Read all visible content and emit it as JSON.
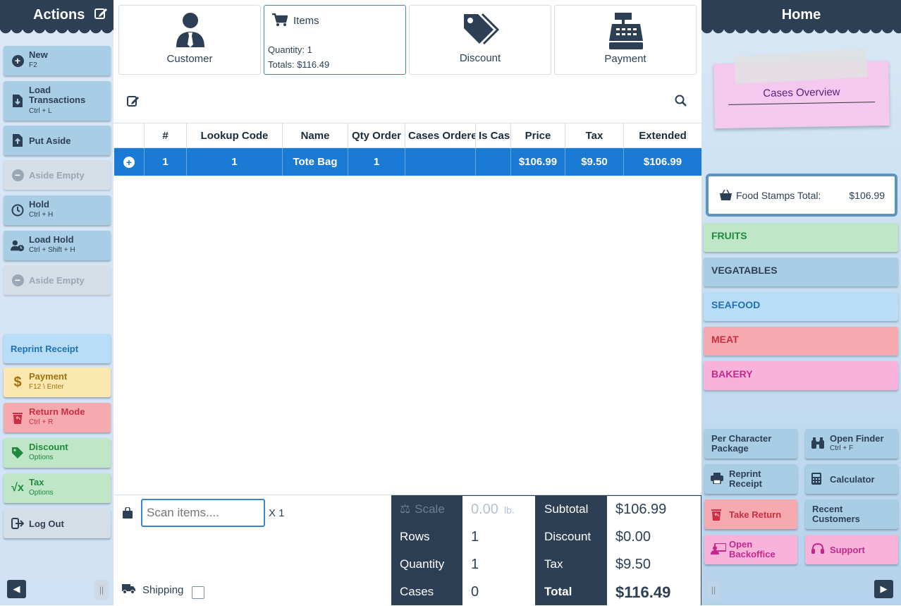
{
  "left_panel": {
    "title": "Actions",
    "buttons": [
      {
        "label": "New",
        "shortcut": "F2"
      },
      {
        "label": "Load",
        "label2": "Transactions",
        "shortcut": "Ctrl + L"
      },
      {
        "label": "Put Aside"
      },
      {
        "label": "Aside Empty"
      },
      {
        "label": "Hold",
        "shortcut": "Ctrl + H"
      },
      {
        "label": "Load Hold",
        "shortcut": "Ctrl + Shift + H"
      },
      {
        "label": "Aside Empty"
      },
      {
        "label": "Reprint Receipt"
      },
      {
        "label": "Payment",
        "shortcut": "F12 \\ Enter"
      },
      {
        "label": "Return Mode",
        "shortcut": "Ctrl + R"
      },
      {
        "label": "Discount",
        "shortcut": "Options"
      },
      {
        "label": "Tax",
        "shortcut": "Options"
      },
      {
        "label": "Log Out"
      }
    ]
  },
  "tiles": {
    "customer": "Customer",
    "items": {
      "title": "Items",
      "quantity_label": "Quantity:",
      "quantity": "1",
      "totals_label": "Totals:",
      "totals": "$116.49"
    },
    "discount": "Discount",
    "payment": "Payment"
  },
  "table": {
    "columns": [
      "#",
      "Lookup Code",
      "Name",
      "Qty Order",
      "Cases Ordere",
      "Is Cas",
      "Price",
      "Tax",
      "Extended"
    ],
    "rows": [
      {
        "num": "1",
        "lookup": "1",
        "name": "Tote Bag",
        "qty": "1",
        "cases": "",
        "is_case": "",
        "price": "$106.99",
        "tax": "$9.50",
        "extended": "$106.99"
      }
    ]
  },
  "scan": {
    "placeholder": "Scan items....",
    "multiplier": "X 1",
    "shipping": "Shipping"
  },
  "summary": {
    "scale_label": "Scale",
    "scale_value": "0.00",
    "scale_unit": "lb.",
    "rows_label": "Rows",
    "rows_value": "1",
    "quantity_label": "Quantity",
    "quantity_value": "1",
    "cases_label": "Cases",
    "cases_value": "0",
    "subtotal_label": "Subtotal",
    "subtotal_value": "$106.99",
    "discount_label": "Discount",
    "discount_value": "$0.00",
    "tax_label": "Tax",
    "tax_value": "$9.50",
    "total_label": "Total",
    "total_value": "$116.49"
  },
  "right_panel": {
    "title": "Home",
    "note": "Cases Overview",
    "food_stamps_label": "Food Stamps Total:",
    "food_stamps_value": "$106.99",
    "categories": [
      {
        "label": "FRUITS",
        "bg": "#bfe6c6",
        "fg": "#1f8a3e"
      },
      {
        "label": "VEGATABLES",
        "bg": "#a9cde5",
        "fg": "#2d3f55"
      },
      {
        "label": "SEAFOOD",
        "bg": "#b9dcf7",
        "fg": "#1f72b8"
      },
      {
        "label": "MEAT",
        "bg": "#f7a9b0",
        "fg": "#cc2e43"
      },
      {
        "label": "BAKERY",
        "bg": "#f7b3da",
        "fg": "#c4288f"
      }
    ],
    "buttons": {
      "per_char_1": "Per Character",
      "per_char_2": "Package",
      "open_finder": "Open Finder",
      "open_finder_sc": "Ctrl + F",
      "reprint_1": "Reprint",
      "reprint_2": "Receipt",
      "calculator": "Calculator",
      "take_return": "Take Return",
      "recent_1": "Recent",
      "recent_2": "Customers",
      "backoffice_1": "Open",
      "backoffice_2": "Backoffice",
      "support": "Support"
    }
  },
  "colors": {
    "dark": "#2d3f55",
    "accent": "#1b7ad4"
  }
}
